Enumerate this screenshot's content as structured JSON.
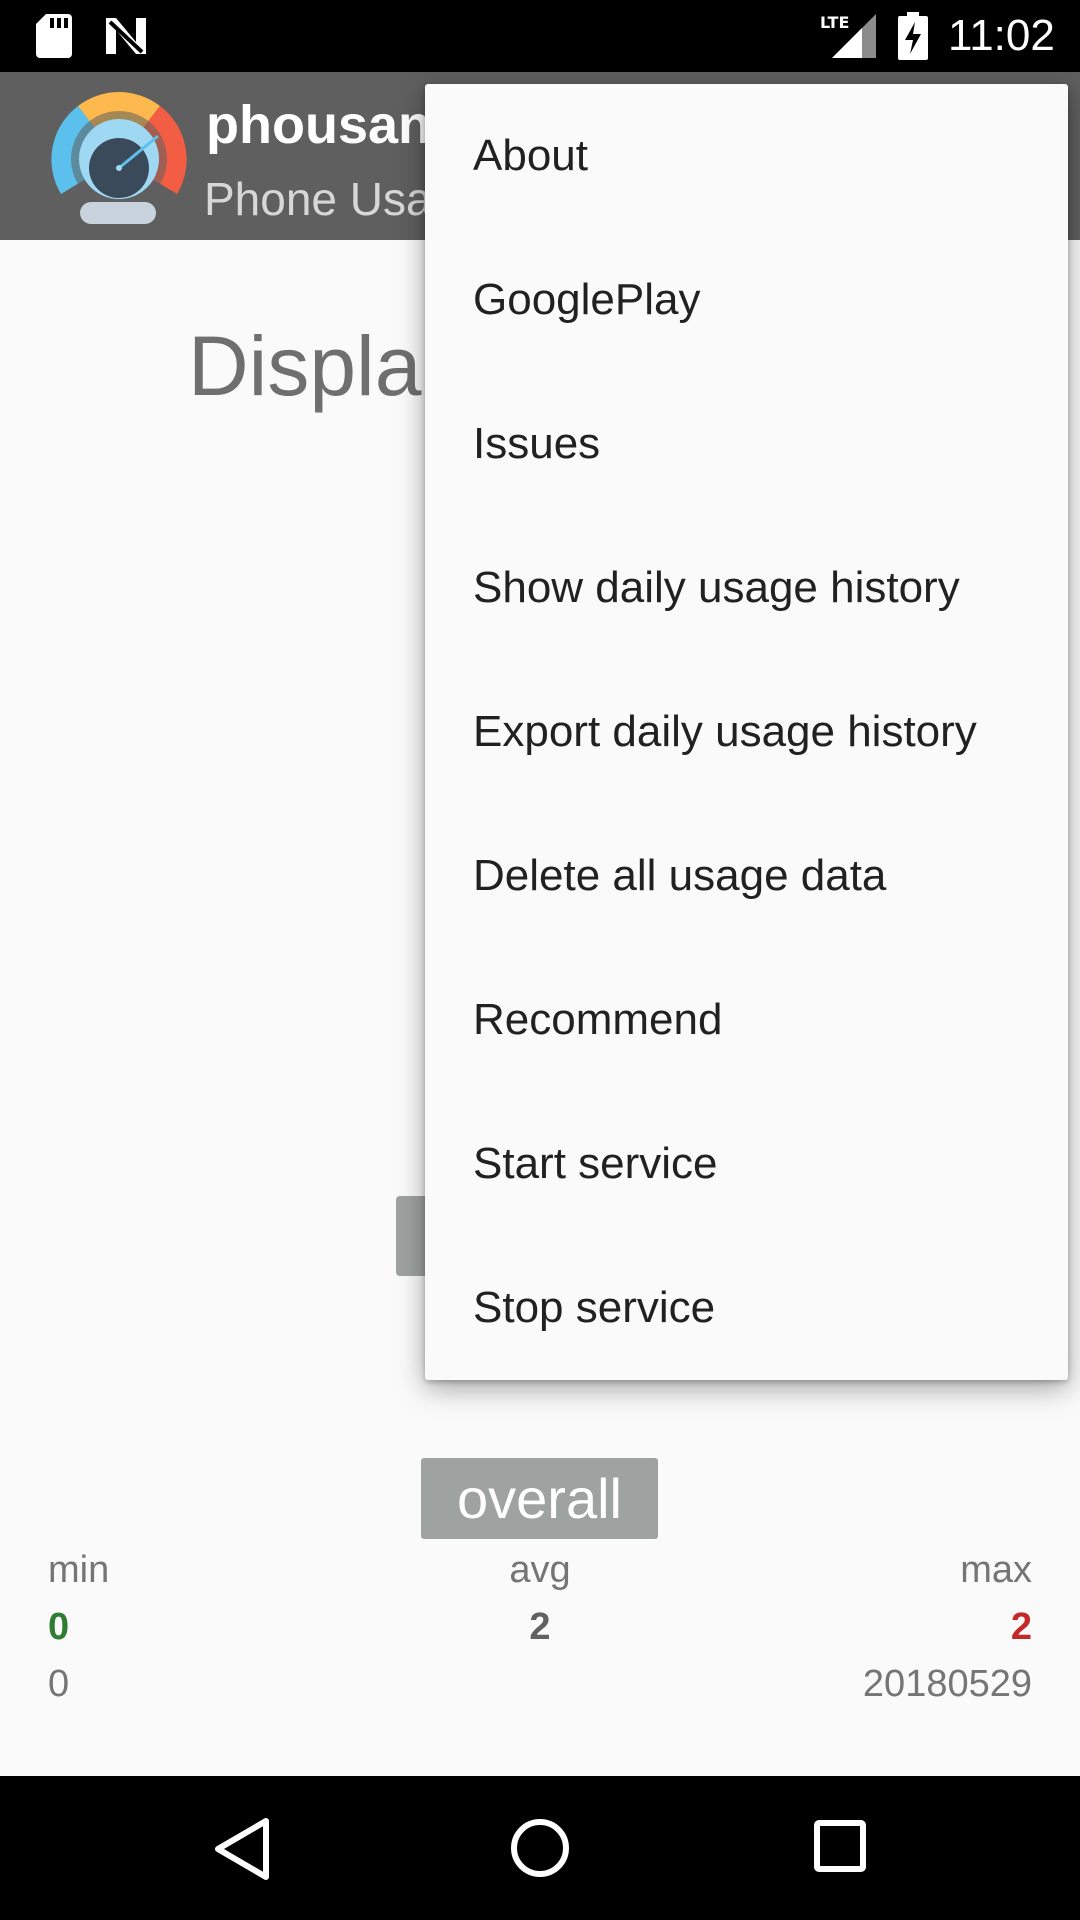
{
  "status_bar": {
    "time": "11:02",
    "network_label": "LTE",
    "icons": [
      "sd-card-icon",
      "n-notification-icon",
      "lte-signal-icon",
      "battery-charging-icon"
    ]
  },
  "app_bar": {
    "title": "phousan",
    "subtitle": "Phone Usa",
    "logo_icon": "speedometer-logo-icon"
  },
  "main": {
    "heading": "Displa",
    "overall_label": "overall",
    "stats": {
      "min_label": "min",
      "avg_label": "avg",
      "max_label": "max",
      "min_value": "0",
      "avg_value": "2",
      "max_value": "2",
      "min_sub": "0",
      "max_sub": "20180529"
    }
  },
  "menu": {
    "items": [
      {
        "label": "About"
      },
      {
        "label": "GooglePlay"
      },
      {
        "label": "Issues"
      },
      {
        "label": "Show daily usage history"
      },
      {
        "label": "Export daily usage history"
      },
      {
        "label": "Delete all usage data"
      },
      {
        "label": "Recommend"
      },
      {
        "label": "Start service"
      },
      {
        "label": "Stop service"
      }
    ]
  },
  "nav_bar": {
    "icons": [
      "back-icon",
      "home-icon",
      "recents-icon"
    ]
  },
  "colors": {
    "status_bar": "#000000",
    "app_bar": "#5f5f5f",
    "background": "#fafafa",
    "min_value": "#2e7d32",
    "max_value": "#c62828",
    "button": "#9ea2a1"
  }
}
